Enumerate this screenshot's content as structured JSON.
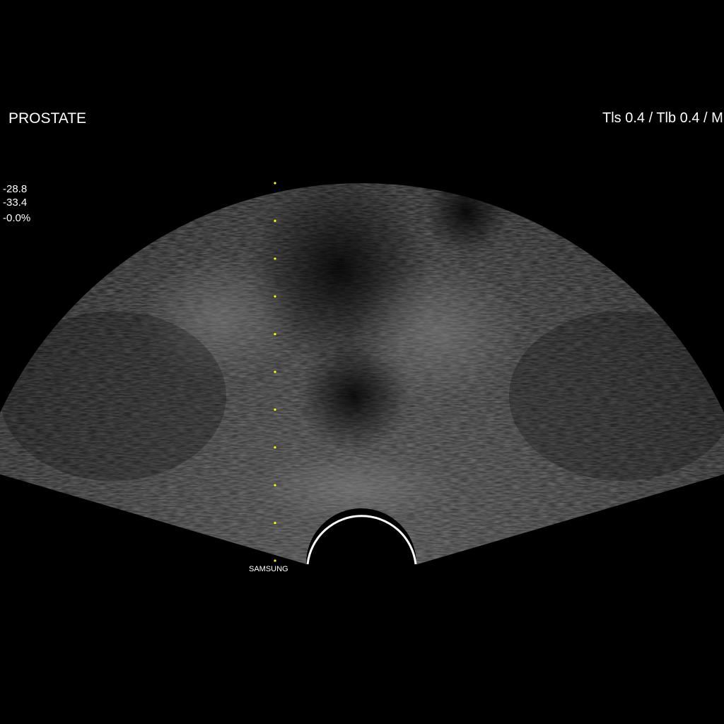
{
  "header": {
    "exam_preset": "PROSTATE",
    "thermal_index": "Tls 0.4 / Tlb  0.4 / M"
  },
  "readouts": [
    "-28.8",
    "-33.4",
    "-0.0%"
  ],
  "brand": "SAMSUNG",
  "depth_markers": {
    "count": 11,
    "color": "#ffff00"
  },
  "colors": {
    "background": "#000000",
    "text": "#ffffff"
  }
}
